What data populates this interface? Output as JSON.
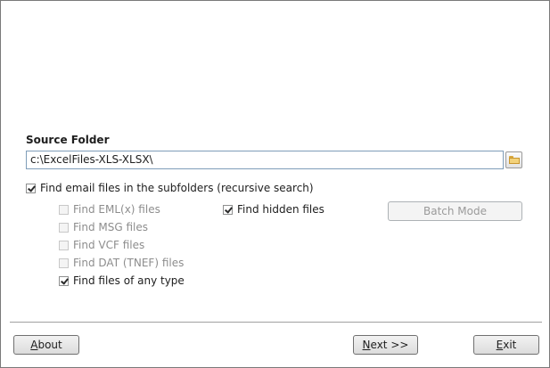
{
  "source_folder": {
    "label": "Source Folder",
    "path_value": "c:\\ExcelFiles-XLS-XLSX\\",
    "browse_icon": "folder-icon"
  },
  "options": {
    "recursive": {
      "label": "Find email files in the subfolders (recursive search)",
      "checked": true,
      "enabled": true
    },
    "eml": {
      "label": "Find EML(x) files",
      "checked": false,
      "enabled": false
    },
    "msg": {
      "label": "Find MSG files",
      "checked": false,
      "enabled": false
    },
    "vcf": {
      "label": "Find VCF files",
      "checked": false,
      "enabled": false
    },
    "dat": {
      "label": "Find DAT (TNEF) files",
      "checked": false,
      "enabled": false
    },
    "any_type": {
      "label": "Find files of any type",
      "checked": true,
      "enabled": true
    },
    "hidden": {
      "label": "Find hidden files",
      "checked": true,
      "enabled": true
    }
  },
  "buttons": {
    "batch_mode": {
      "label": "Batch Mode",
      "enabled": false
    },
    "about": {
      "mnemonic": "A",
      "rest": "bout"
    },
    "next": {
      "mnemonic": "N",
      "rest": "ext >>"
    },
    "exit": {
      "mnemonic": "E",
      "rest": "xit"
    }
  }
}
